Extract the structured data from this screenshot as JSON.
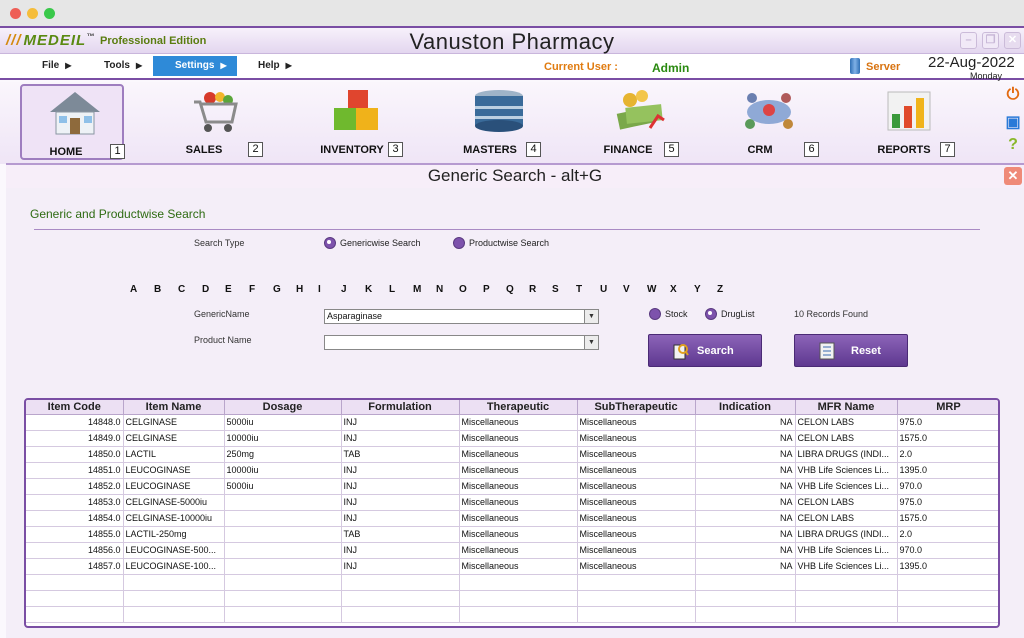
{
  "app": {
    "logo_text": "MEDEIL",
    "edition": "Professional Edition",
    "title": "Vanuston Pharmacy"
  },
  "menu": {
    "items": [
      "File",
      "Tools",
      "Settings",
      "Help"
    ],
    "current_user_label": "Current User :",
    "current_user": "Admin",
    "server_label": "Server",
    "date": "22-Aug-2022",
    "day": "Monday"
  },
  "modules": [
    {
      "label": "HOME",
      "key": "1",
      "icon": "house-icon"
    },
    {
      "label": "SALES",
      "key": "2",
      "icon": "shopping-cart-icon"
    },
    {
      "label": "INVENTORY",
      "key": "3",
      "icon": "boxes-icon"
    },
    {
      "label": "MASTERS",
      "key": "4",
      "icon": "database-icon"
    },
    {
      "label": "FINANCE",
      "key": "5",
      "icon": "money-icon"
    },
    {
      "label": "CRM",
      "key": "6",
      "icon": "people-network-icon"
    },
    {
      "label": "REPORTS",
      "key": "7",
      "icon": "chart-icon"
    }
  ],
  "panel": {
    "title": "Generic Search - alt+G",
    "section_title": "Generic and Productwise Search"
  },
  "search": {
    "search_type_label": "Search Type",
    "type_generic": "Genericwise Search",
    "type_product": "Productwise Search",
    "alphabet": [
      "A",
      "B",
      "C",
      "D",
      "E",
      "F",
      "G",
      "H",
      "I",
      "J",
      "K",
      "L",
      "M",
      "N",
      "O",
      "P",
      "Q",
      "R",
      "S",
      "T",
      "U",
      "V",
      "W",
      "X",
      "Y",
      "Z"
    ],
    "generic_name_label": "GenericName",
    "generic_name_value": "Asparaginase",
    "product_name_label": "Product Name",
    "product_name_value": "",
    "stock_label": "Stock",
    "druglist_label": "DrugList",
    "records_found": "10 Records Found",
    "search_button": "Search",
    "reset_button": "Reset"
  },
  "table": {
    "columns": [
      "Item Code",
      "Item Name",
      "Dosage",
      "Formulation",
      "Therapeutic",
      "SubTherapeutic",
      "Indication",
      "MFR Name",
      "MRP"
    ],
    "rows": [
      [
        "14848.0",
        "CELGINASE",
        "5000iu",
        "INJ",
        "Miscellaneous",
        "Miscellaneous",
        "NA",
        "CELON LABS",
        "975.0"
      ],
      [
        "14849.0",
        "CELGINASE",
        "10000iu",
        "INJ",
        "Miscellaneous",
        "Miscellaneous",
        "NA",
        "CELON LABS",
        "1575.0"
      ],
      [
        "14850.0",
        "LACTIL",
        "250mg",
        "TAB",
        "Miscellaneous",
        "Miscellaneous",
        "NA",
        "LIBRA DRUGS (INDI...",
        "2.0"
      ],
      [
        "14851.0",
        "LEUCOGINASE",
        "10000iu",
        "INJ",
        "Miscellaneous",
        "Miscellaneous",
        "NA",
        "VHB Life Sciences Li...",
        "1395.0"
      ],
      [
        "14852.0",
        "LEUCOGINASE",
        "5000iu",
        "INJ",
        "Miscellaneous",
        "Miscellaneous",
        "NA",
        "VHB Life Sciences Li...",
        "970.0"
      ],
      [
        "14853.0",
        "CELGINASE-5000iu",
        "",
        "INJ",
        "Miscellaneous",
        "Miscellaneous",
        "NA",
        "CELON LABS",
        "975.0"
      ],
      [
        "14854.0",
        "CELGINASE-10000iu",
        "",
        "INJ",
        "Miscellaneous",
        "Miscellaneous",
        "NA",
        "CELON LABS",
        "1575.0"
      ],
      [
        "14855.0",
        "LACTIL-250mg",
        "",
        "TAB",
        "Miscellaneous",
        "Miscellaneous",
        "NA",
        "LIBRA DRUGS (INDI...",
        "2.0"
      ],
      [
        "14856.0",
        "LEUCOGINASE-500...",
        "",
        "INJ",
        "Miscellaneous",
        "Miscellaneous",
        "NA",
        "VHB Life Sciences Li...",
        "970.0"
      ],
      [
        "14857.0",
        "LEUCOGINASE-100...",
        "",
        "INJ",
        "Miscellaneous",
        "Miscellaneous",
        "NA",
        "VHB Life Sciences Li...",
        "1395.0"
      ]
    ],
    "empty_rows": 3
  }
}
